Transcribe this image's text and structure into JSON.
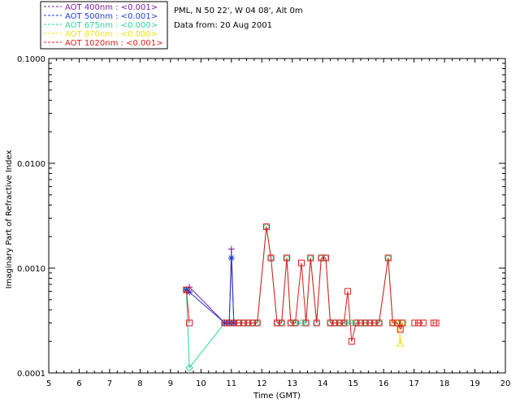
{
  "chart_data": {
    "type": "line",
    "info": {
      "location": "PML, N 50 22', W 04 08', Alt 0m",
      "date": "Data from: 20 Aug 2001"
    },
    "xlabel": "Time (GMT)",
    "ylabel": "Imaginary Part of Refractive Index",
    "x_ticks": [
      "5",
      "6",
      "7",
      "8",
      "9",
      "10",
      "11",
      "12",
      "13",
      "14",
      "15",
      "16",
      "17",
      "18",
      "19",
      "20"
    ],
    "y_ticks": [
      "0.0001",
      "0.0010",
      "0.0100",
      "0.1000"
    ],
    "xlim": [
      5,
      20
    ],
    "ylim": [
      0.0001,
      0.1
    ],
    "y_scale": "log",
    "grid": false,
    "legend_position": "top-left",
    "series": [
      {
        "name": "AOT  400nm : <0.001>",
        "color": "#7a1fa2",
        "marker": "plus",
        "x": [
          9.52,
          9.62,
          10.78,
          10.93,
          11.0,
          11.08
        ],
        "y": [
          0.00062,
          0.00066,
          0.0003,
          0.0003,
          0.00152,
          0.0003
        ]
      },
      {
        "name": "AOT  500nm : <0.001>",
        "color": "#1f3fd2",
        "marker": "asterisk",
        "x": [
          9.52,
          9.62,
          10.78,
          10.93,
          11.0,
          11.08
        ],
        "y": [
          0.00062,
          0.00059,
          0.0003,
          0.0003,
          0.00125,
          0.0003
        ]
      },
      {
        "name": "AOT  675nm : <0.000>",
        "color": "#2ed6a0",
        "marker": "diamond",
        "x": [
          9.52,
          9.62,
          10.78,
          10.93,
          11.08,
          11.24,
          11.4,
          11.55,
          11.7,
          11.85,
          12.15,
          12.3,
          12.5,
          12.65,
          12.82,
          12.95,
          13.1,
          13.3,
          13.45,
          13.6,
          13.8,
          13.95,
          14.1,
          14.25,
          14.4,
          14.55,
          14.7,
          14.82,
          14.95,
          15.1,
          15.25,
          15.4,
          15.55,
          15.7,
          15.85,
          16.15,
          16.3,
          16.45,
          16.62
        ],
        "y": [
          0.00062,
          0.000112,
          0.0003,
          0.0003,
          0.0003,
          0.0003,
          0.0003,
          0.0003,
          0.0003,
          0.0003,
          0.00248,
          0.00125,
          0.0003,
          0.0003,
          0.00125,
          0.0003,
          0.0003,
          0.0003,
          0.0003,
          0.00125,
          0.0003,
          0.00125,
          0.00125,
          0.0003,
          0.0003,
          0.0003,
          0.0003,
          0.0003,
          0.0003,
          0.0003,
          0.0003,
          0.0003,
          0.0003,
          0.0003,
          0.0003,
          0.00125,
          0.0003,
          0.0003,
          0.0003
        ]
      },
      {
        "name": "AOT  870nm : <0.000>",
        "color": "#f0e21a",
        "marker": "triangle",
        "x": [
          16.3,
          16.45,
          16.55,
          16.62
        ],
        "y": [
          0.0003,
          0.0003,
          0.00019,
          0.0003
        ]
      },
      {
        "name": "AOT 1020nm : <0.001>",
        "color": "#e01b1b",
        "marker": "square",
        "x": [
          9.52,
          9.62,
          10.78,
          10.93,
          11.08,
          11.24,
          11.4,
          11.55,
          11.7,
          11.85,
          12.15,
          12.3,
          12.5,
          12.65,
          12.82,
          12.95,
          13.1,
          13.3,
          13.45,
          13.6,
          13.8,
          13.95,
          14.1,
          14.25,
          14.4,
          14.55,
          14.7,
          14.82,
          14.95,
          15.1,
          15.25,
          15.4,
          15.55,
          15.7,
          15.85,
          16.15,
          16.3,
          16.45,
          16.55,
          16.62,
          17.02,
          17.15,
          17.3,
          17.65,
          17.72
        ],
        "y": [
          0.00062,
          0.0003,
          0.0003,
          0.0003,
          0.0003,
          0.0003,
          0.0003,
          0.0003,
          0.0003,
          0.0003,
          0.00248,
          0.00125,
          0.0003,
          0.0003,
          0.00125,
          0.0003,
          0.0003,
          0.00112,
          0.0003,
          0.00125,
          0.0003,
          0.00125,
          0.00125,
          0.0003,
          0.0003,
          0.0003,
          0.0003,
          0.0006,
          0.0002,
          0.0003,
          0.0003,
          0.0003,
          0.0003,
          0.0003,
          0.0003,
          0.00125,
          0.0003,
          0.0003,
          0.00026,
          0.0003,
          0.0003,
          0.0003,
          0.0003,
          0.0003,
          0.0003
        ],
        "segments_break_after": [
          9.62,
          16.62,
          17.3
        ]
      }
    ]
  }
}
